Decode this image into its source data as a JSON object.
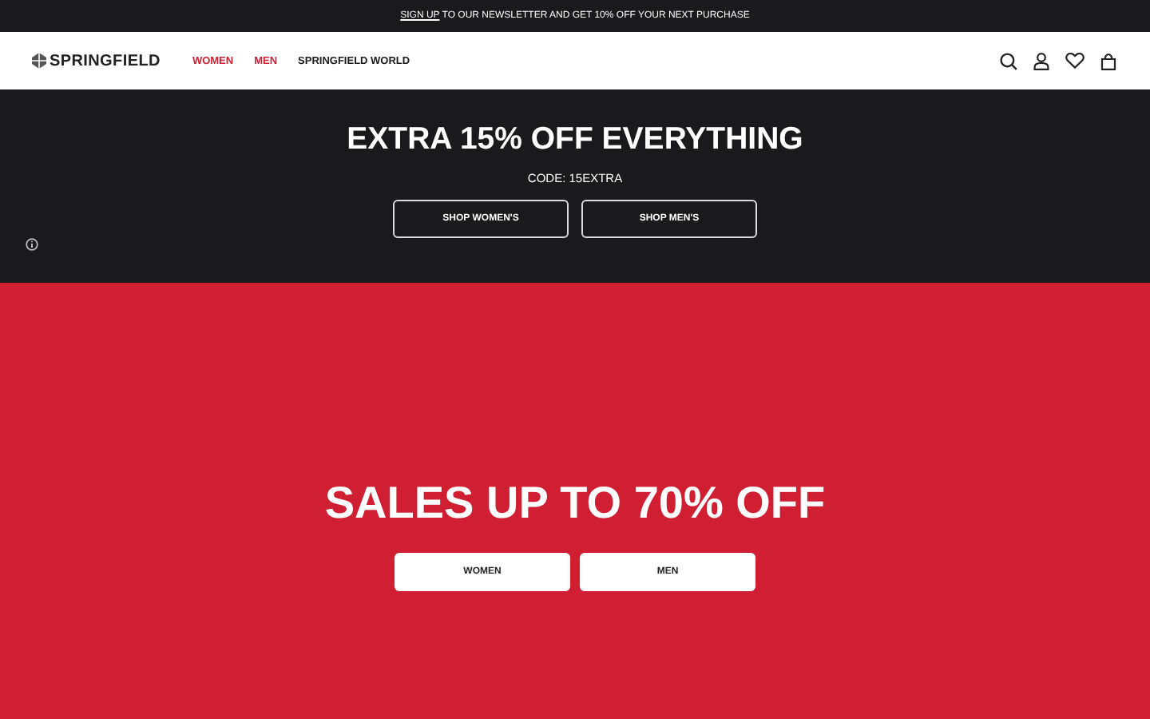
{
  "announcement": {
    "link": "SIGN UP",
    "text": " TO OUR NEWSLETTER AND GET 10% OFF YOUR NEXT PURCHASE"
  },
  "header": {
    "logo": "SPRINGFIELD",
    "nav": [
      {
        "label": "WOMEN",
        "color": "#d01f33"
      },
      {
        "label": "MEN",
        "color": "#d01f33"
      },
      {
        "label": "SPRINGFIELD WORLD",
        "color": "#1a1a1a"
      }
    ]
  },
  "promo": {
    "title": "EXTRA 15% OFF EVERYTHING",
    "code": "CODE: 15EXTRA",
    "buttons": [
      "SHOP WOMEN'S",
      "SHOP MEN'S"
    ]
  },
  "sale": {
    "title": "SALES UP TO 70% OFF",
    "buttons": [
      "WOMEN",
      "MEN"
    ]
  }
}
